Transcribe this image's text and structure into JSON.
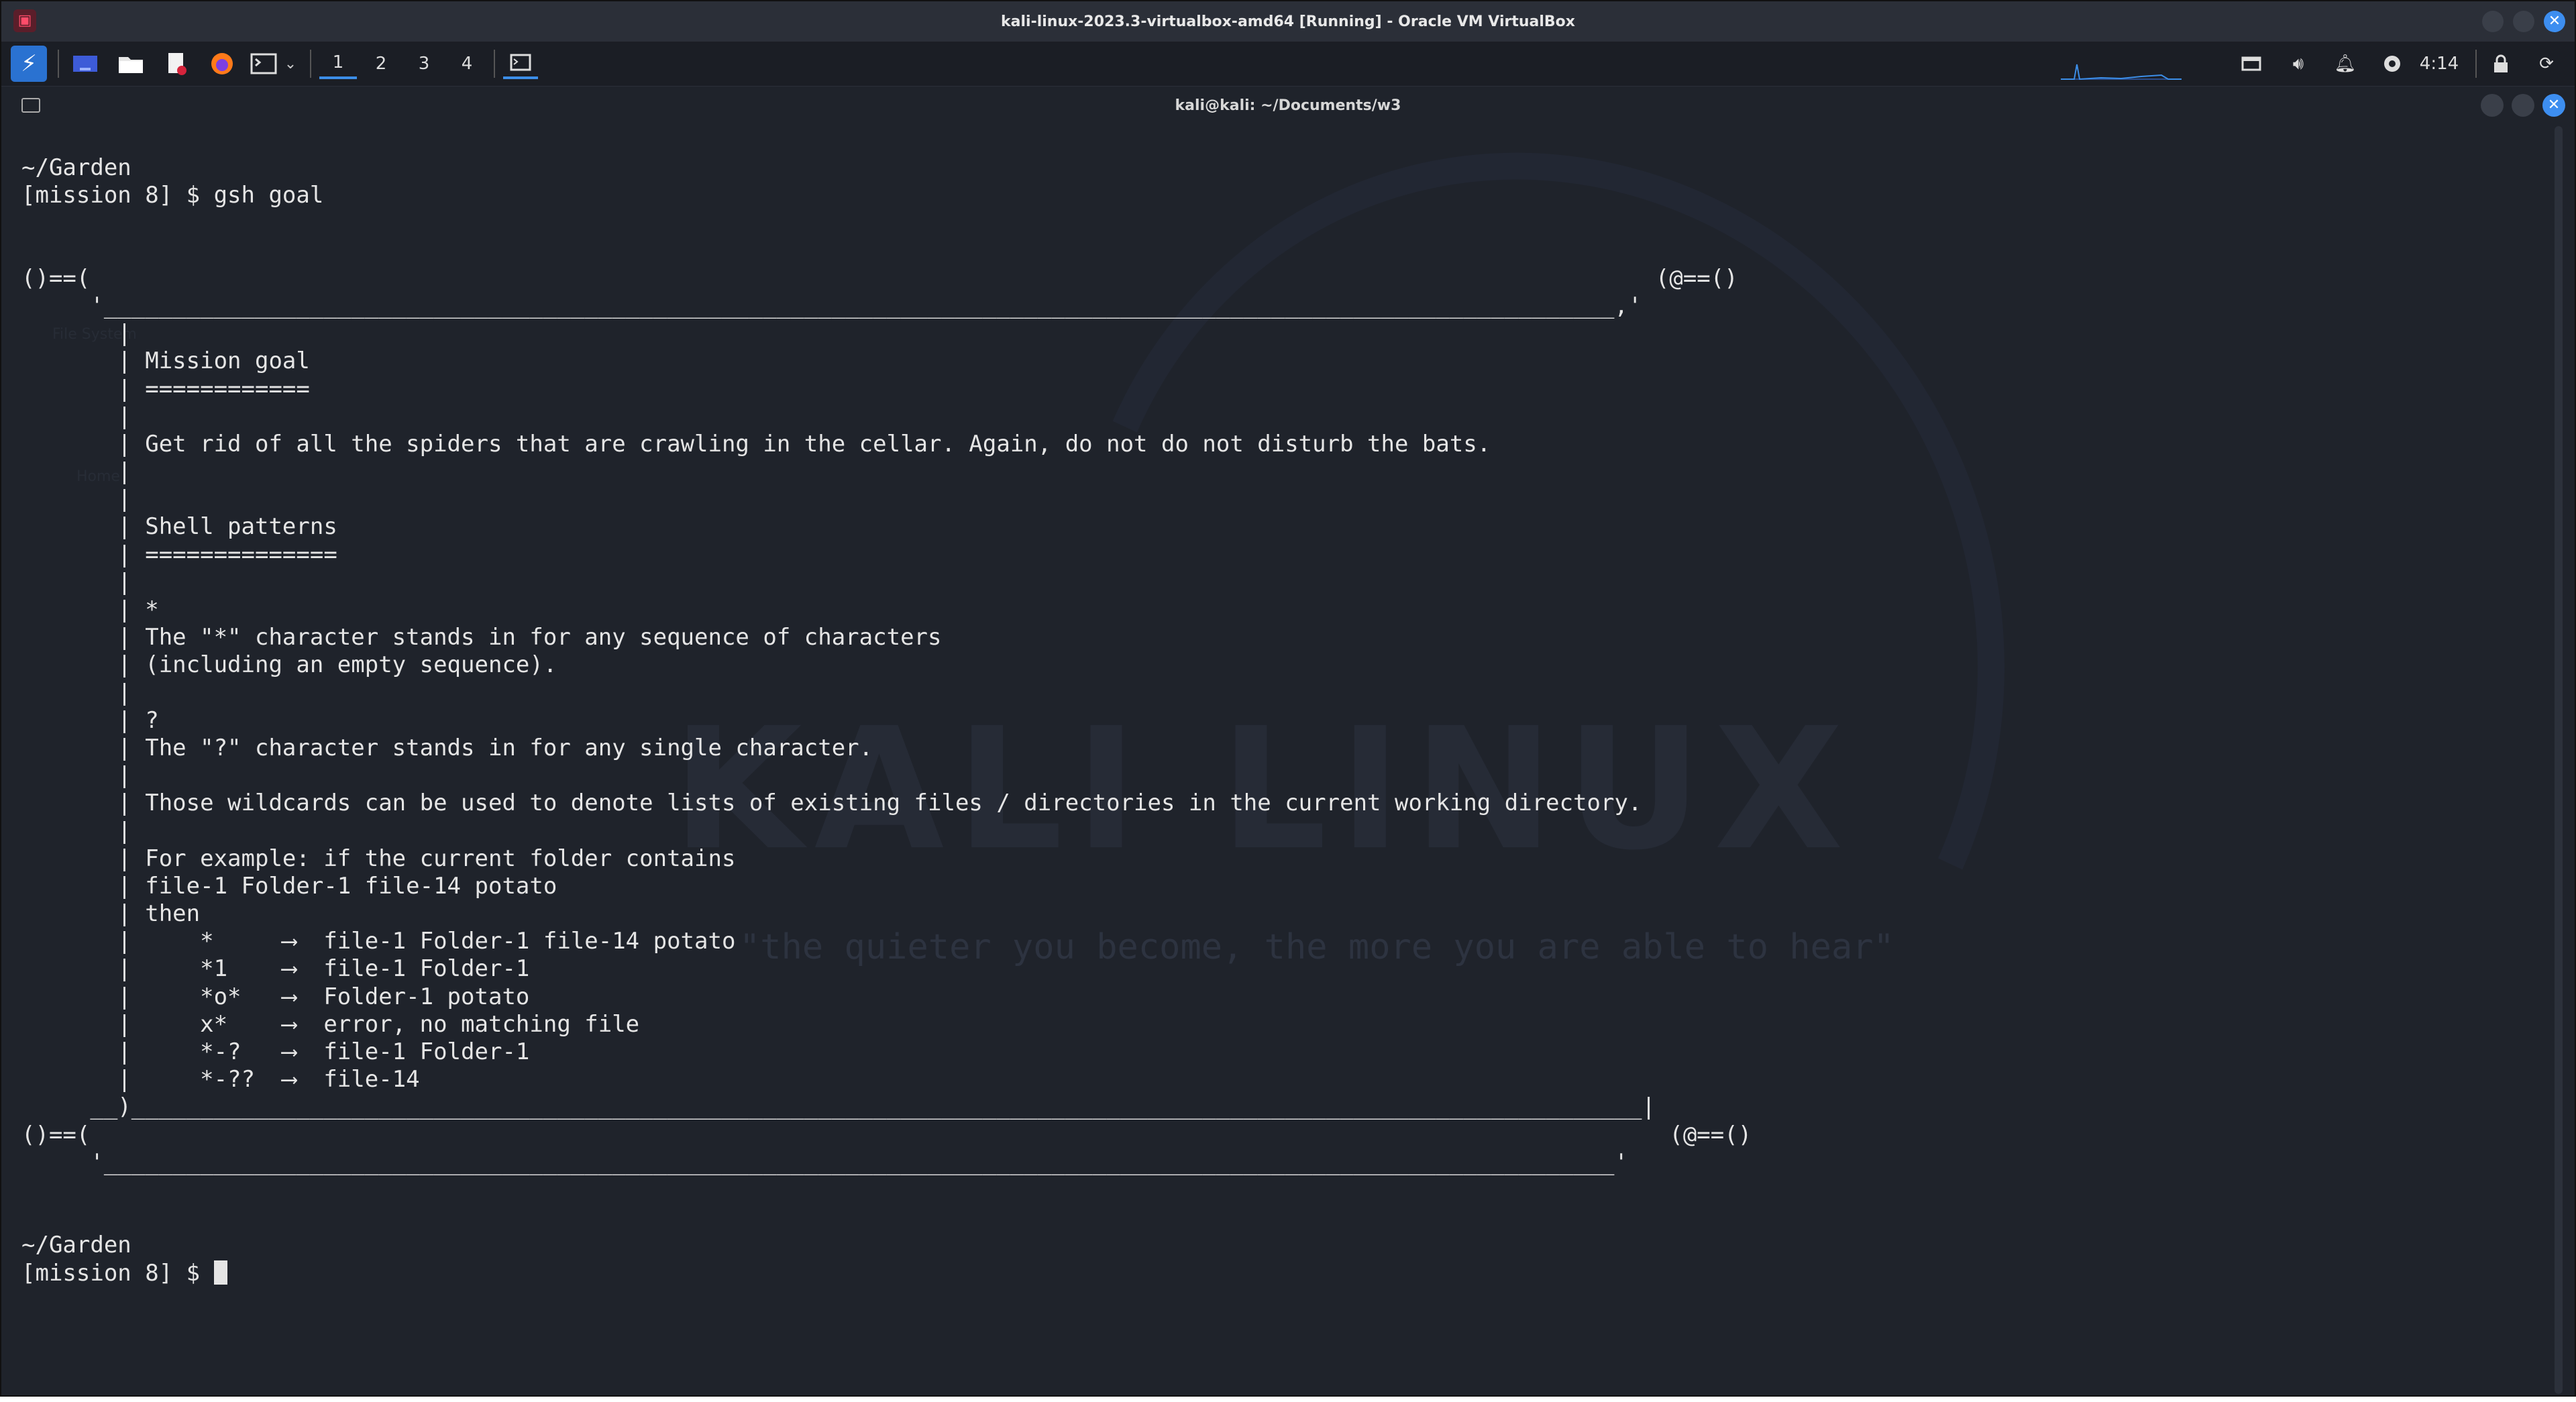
{
  "vbox": {
    "title": "kali-linux-2023.3-virtualbox-amd64 [Running] - Oracle VM VirtualBox",
    "close_glyph": "✕"
  },
  "panel": {
    "workspaces": [
      "1",
      "2",
      "3",
      "4"
    ],
    "active_workspace": "1",
    "clock": "4:14",
    "accent": "#3c8ee8"
  },
  "terminal": {
    "title": "kali@kali: ~/Documents/w3",
    "close_glyph": "✕",
    "wallpaper_title": "KALI LINUX",
    "wallpaper_tagline": "\"the quieter you become, the more you are able to hear\"",
    "lines": [
      "~/Garden",
      "[mission 8] $ gsh goal",
      "",
      "",
      "()==(                                                                                                                  (@==()",
      "     '______________________________________________________________________________________________________________,'",
      "       |",
      "       | Mission goal",
      "       | ============",
      "       |",
      "       | Get rid of all the spiders that are crawling in the cellar. Again, do not do not disturb the bats.",
      "       |",
      "       |",
      "       | Shell patterns",
      "       | ==============",
      "       |",
      "       | *",
      "       | The \"*\" character stands in for any sequence of characters",
      "       | (including an empty sequence).",
      "       |",
      "       | ?",
      "       | The \"?\" character stands in for any single character.",
      "       |",
      "       | Those wildcards can be used to denote lists of existing files / directories in the current working directory.",
      "       |",
      "       | For example: if the current folder contains",
      "       | file-1 Folder-1 file-14 potato",
      "       | then",
      "       |     *     ⟶  file-1 Folder-1 file-14 potato",
      "       |     *1    ⟶  file-1 Folder-1",
      "       |     *o*   ⟶  Folder-1 potato",
      "       |     x*    ⟶  error, no matching file",
      "       |     *-?   ⟶  file-1 Folder-1",
      "       |     *-??  ⟶  file-14",
      "     __)______________________________________________________________________________________________________________|",
      "()==(                                                                                                                   (@==()",
      "     '______________________________________________________________________________________________________________'",
      "",
      "",
      "~/Garden"
    ],
    "prompt": "[mission 8] $ "
  },
  "desktop_ghosts": [
    "File System",
    "Home"
  ]
}
